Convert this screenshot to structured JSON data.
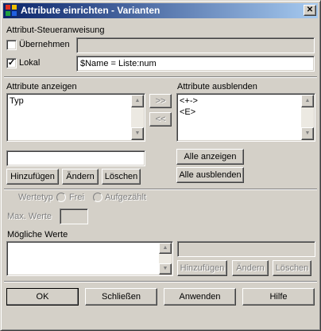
{
  "window": {
    "title": "Attribute einrichten - Varianten",
    "close_glyph": "✕"
  },
  "steuer": {
    "group_label": "Attribut-Steueranweisung",
    "uebernehmen_label": "Übernehmen",
    "uebernehmen_checked": false,
    "lokal_label": "Lokal",
    "lokal_checked": true,
    "lokal_value": "$Name = Liste:num",
    "check_glyph": "✓"
  },
  "anzeigen": {
    "label": "Attribute anzeigen",
    "items": [
      "Typ"
    ],
    "input_value": "",
    "buttons": {
      "add": "Hinzufügen",
      "edit": "Ändern",
      "delete": "Löschen"
    }
  },
  "transfer": {
    "right": ">>",
    "left": "<<"
  },
  "ausblenden": {
    "label": "Attribute ausblenden",
    "items": [
      "<+->",
      "<E>"
    ],
    "show_all": "Alle anzeigen",
    "hide_all": "Alle ausblenden"
  },
  "werte": {
    "type_label": "Wertetyp",
    "frei_label": "Frei",
    "aufgezaehlt_label": "Aufgezählt",
    "max_label": "Max. Werte",
    "max_value": "",
    "possible_label": "Mögliche Werte",
    "buttons": {
      "add": "Hinzufügen",
      "edit": "Ändern",
      "delete": "Löschen"
    }
  },
  "footer": {
    "ok": "OK",
    "close": "Schließen",
    "apply": "Anwenden",
    "help": "Hilfe"
  },
  "scroll": {
    "up": "▲",
    "down": "▼"
  },
  "colors": {
    "title_start": "#0a246a",
    "title_end": "#a6caf0",
    "face": "#d4d0c8"
  }
}
